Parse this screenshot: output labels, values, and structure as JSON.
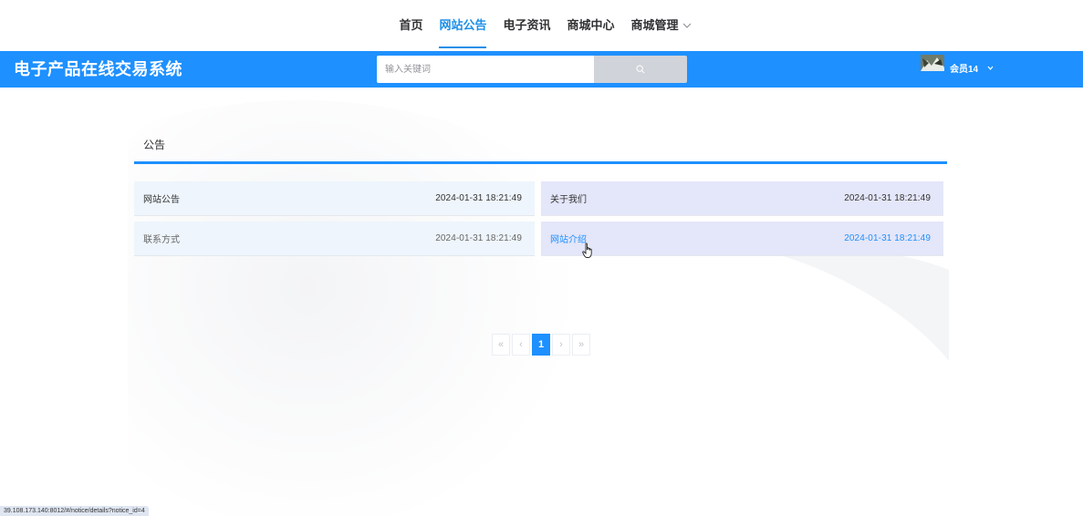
{
  "nav": {
    "items": [
      {
        "label": "首页",
        "active": false
      },
      {
        "label": "网站公告",
        "active": true
      },
      {
        "label": "电子资讯",
        "active": false
      },
      {
        "label": "商城中心",
        "active": false
      },
      {
        "label": "商城管理",
        "active": false,
        "has_dropdown": true
      }
    ]
  },
  "header": {
    "site_title": "电子产品在线交易系统",
    "search_placeholder": "输入关键词",
    "user_name": "会员14",
    "accent_color": "#1e90ff"
  },
  "section": {
    "title": "公告"
  },
  "notices": [
    {
      "title": "网站公告",
      "date": "2024-01-31 18:21:49"
    },
    {
      "title": "关于我们",
      "date": "2024-01-31 18:21:49"
    },
    {
      "title": "联系方式",
      "date": "2024-01-31 18:21:49"
    },
    {
      "title": "网站介绍",
      "date": "2024-01-31 18:21:49",
      "hovered": true
    }
  ],
  "pagination": {
    "first": "«",
    "prev": "‹",
    "current": "1",
    "next": "›",
    "last": "»"
  },
  "status_bar": {
    "url": "39.108.173.140:8012/#/notice/details?notice_id=4"
  },
  "icons": {
    "search": "search-icon",
    "dropdown": "chevron-down-icon",
    "cursor": "hand-pointer-icon"
  }
}
